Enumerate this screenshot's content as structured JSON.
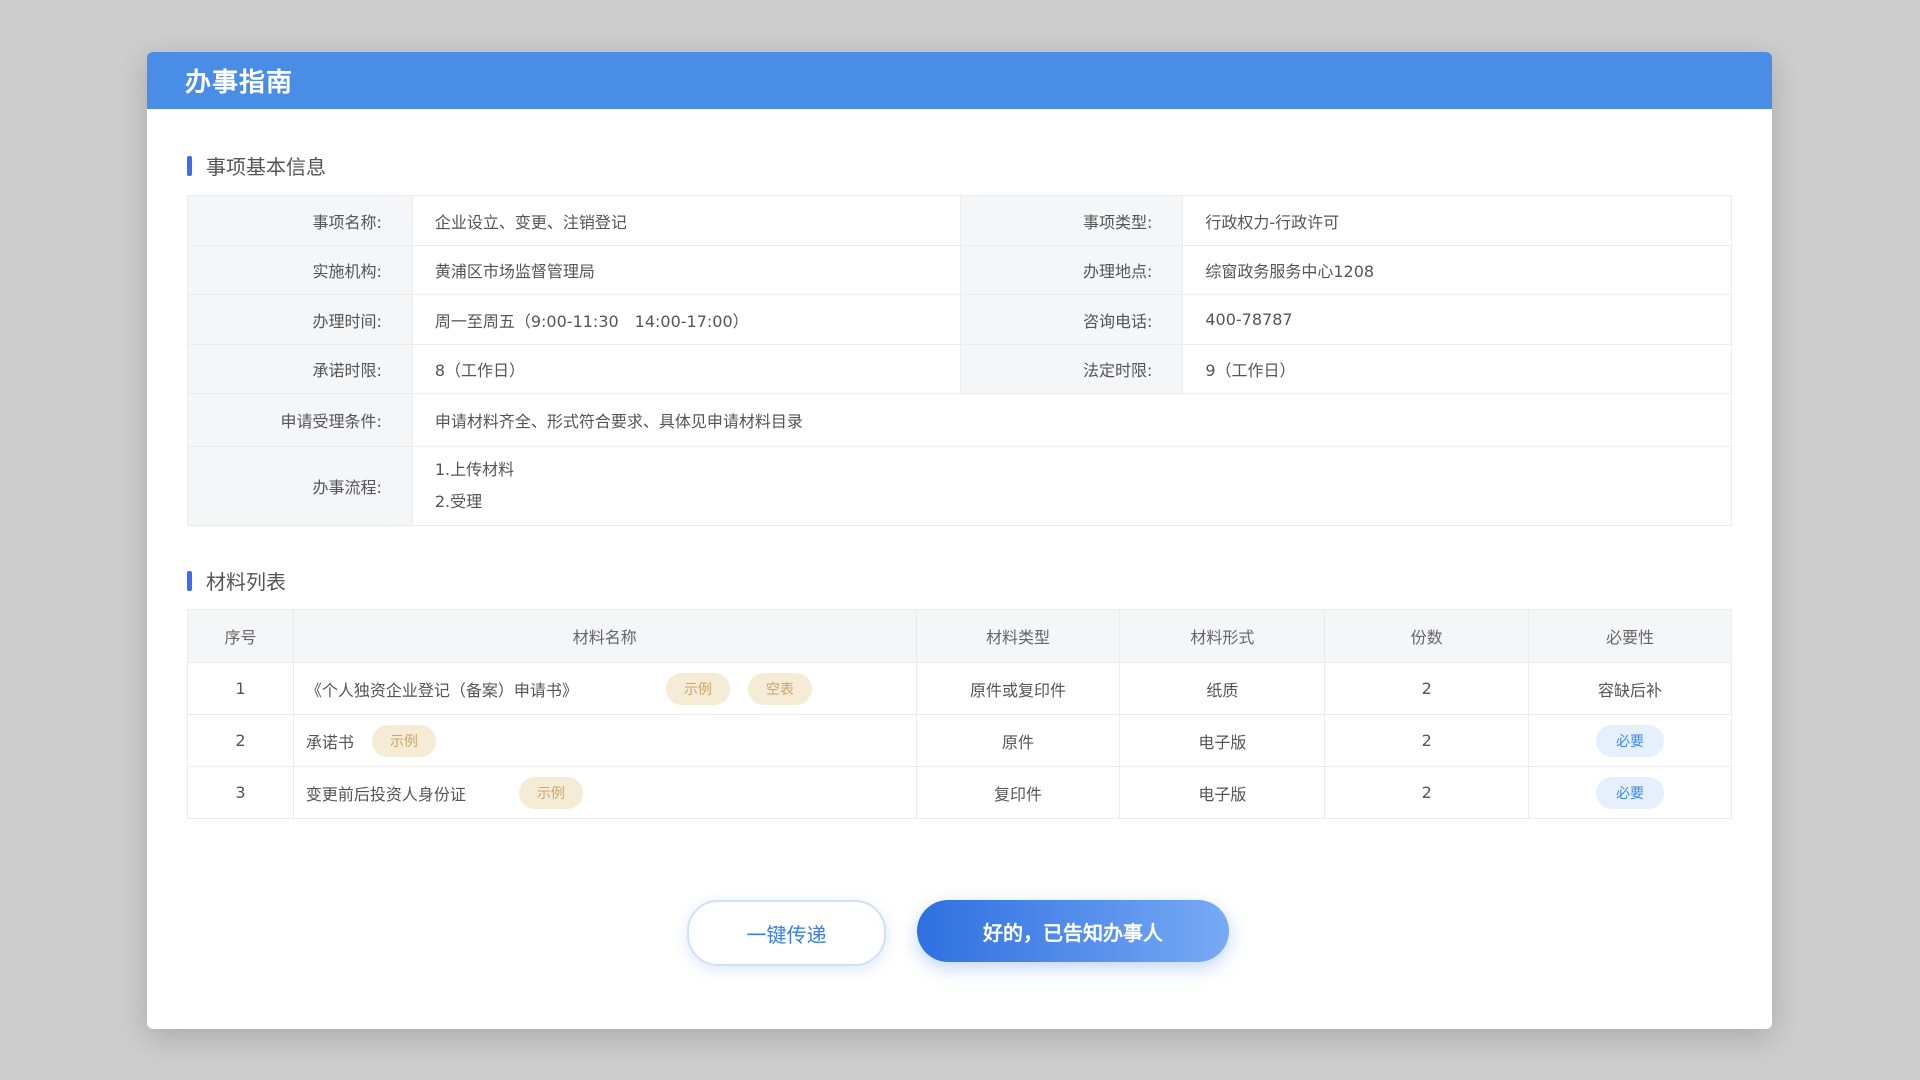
{
  "dialog": {
    "title": "办事指南"
  },
  "basic_info": {
    "section_title": "事项基本信息",
    "rows": [
      {
        "label1": "事项名称:",
        "value1": "企业设立、变更、注销登记",
        "label2": "事项类型:",
        "value2": "行政权力-行政许可"
      },
      {
        "label1": "实施机构:",
        "value1": "黄浦区市场监督管理局",
        "label2": "办理地点:",
        "value2": "综窗政务服务中心1208"
      },
      {
        "label1": "办理时间:",
        "value1": "周一至周五（9:00-11:30　14:00-17:00）",
        "label2": "咨询电话:",
        "value2": "400-78787"
      },
      {
        "label1": "承诺时限:",
        "value1": "8（工作日）",
        "label2": "法定时限:",
        "value2": "9（工作日）"
      }
    ],
    "condition_label": "申请受理条件:",
    "condition_value": "申请材料齐全、形式符合要求、具体见申请材料目录",
    "process_label": "办事流程:",
    "process_steps": [
      "1.上传材料",
      "2.受理"
    ]
  },
  "materials": {
    "section_title": "材料列表",
    "headers": [
      "序号",
      "材料名称",
      "材料类型",
      "材料形式",
      "份数",
      "必要性"
    ],
    "rows": [
      {
        "no": "1",
        "name": "《个人独资企业登记（备案）申请书》",
        "tags": [
          "示例",
          "空表"
        ],
        "type": "原件或复印件",
        "form": "纸质",
        "copies": "2",
        "necessity": "容缺后补",
        "necessity_tag": false
      },
      {
        "no": "2",
        "name": "承诺书",
        "tags": [
          "示例"
        ],
        "type": "原件",
        "form": "电子版",
        "copies": "2",
        "necessity": "必要",
        "necessity_tag": true
      },
      {
        "no": "3",
        "name": "变更前后投资人身份证",
        "tags": [
          "示例"
        ],
        "type": "复印件",
        "form": "电子版",
        "copies": "2",
        "necessity": "必要",
        "necessity_tag": true
      }
    ]
  },
  "buttons": {
    "secondary": "一键传递",
    "primary": "好的，已告知办事人"
  },
  "colors": {
    "header_bg": "#4a8de6",
    "accent": "#3b6df0",
    "tag_bg": "#f6ecd6",
    "tag_text": "#c9a56a",
    "required_bg": "#e6f0fd",
    "required_text": "#3e86ee"
  }
}
